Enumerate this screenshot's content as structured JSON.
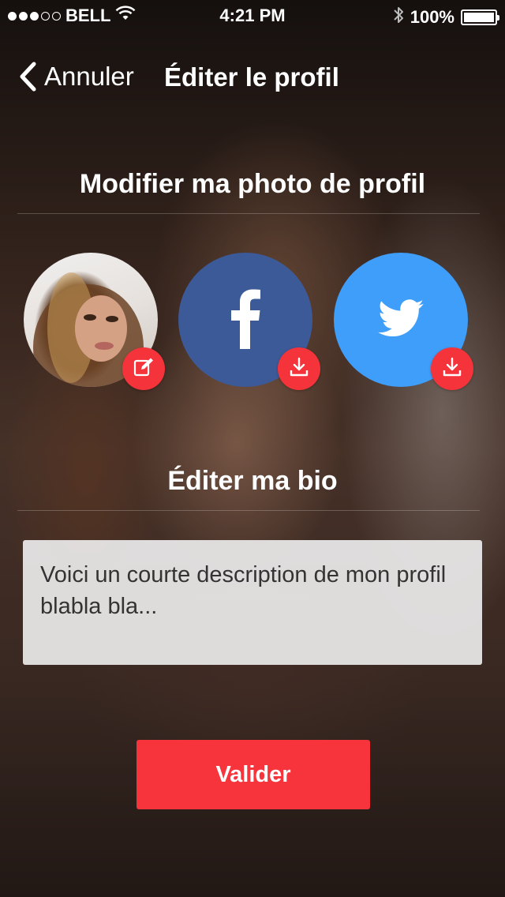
{
  "status_bar": {
    "carrier": "BELL",
    "signal_dots_filled": 3,
    "signal_dots_total": 5,
    "time": "4:21 PM",
    "battery": "100%",
    "battery_level": 1.0
  },
  "nav": {
    "back_label": "Annuler",
    "title": "Éditer le profil"
  },
  "photo_section": {
    "title": "Modifier ma photo de profil",
    "sources": [
      {
        "name": "profile-photo",
        "icon": "edit-icon",
        "color": "#f5333b"
      },
      {
        "name": "facebook",
        "icon": "facebook-icon",
        "bg_color": "#3d5a98",
        "action_icon": "download-icon"
      },
      {
        "name": "twitter",
        "icon": "twitter-icon",
        "bg_color": "#3f9ef9",
        "action_icon": "download-icon"
      }
    ]
  },
  "bio_section": {
    "title": "Éditer ma bio",
    "value": "Voici un courte description de mon profil blabla bla..."
  },
  "submit": {
    "label": "Valider",
    "color": "#f7343c"
  }
}
